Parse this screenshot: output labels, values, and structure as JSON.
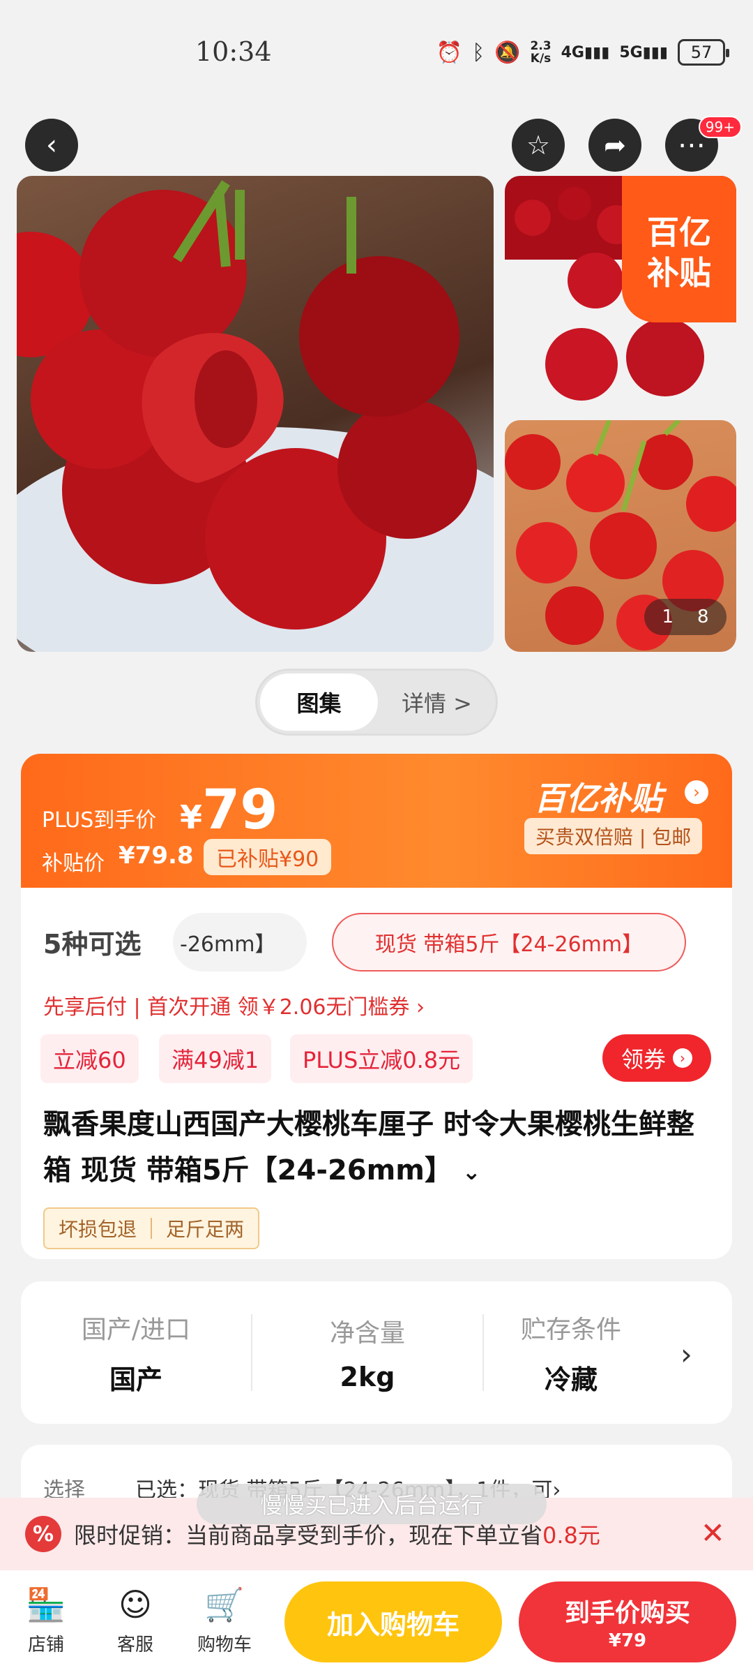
{
  "status": {
    "time": "10:34",
    "net_speed": "2.3\nK/s",
    "battery": "57",
    "icons": [
      "alarm-icon",
      "bluetooth-icon",
      "mute-icon",
      "signal-4g-icon",
      "signal-5g-icon"
    ]
  },
  "nav": {
    "badge": "99+"
  },
  "gallery": {
    "subsidy_corner": "百亿\n补贴",
    "counter_current": "1",
    "counter_total": "8"
  },
  "tabs": [
    {
      "label": "图集"
    },
    {
      "label": "详情 >"
    }
  ],
  "price": {
    "plus_label": "PLUS到手价",
    "currency": "¥",
    "plus_price": "79",
    "subsidy_label": "补贴价",
    "subsidy_price": "¥79.8",
    "subsidized_tag": "已补贴¥90",
    "brand": "百亿补贴",
    "guarantee": "买贵双倍赔 | 包邮"
  },
  "variants": {
    "count_label": "5种可选",
    "pill_text": "-26mm】",
    "selected": "现货 带箱5斤【24-26mm】"
  },
  "credit_line": "先享后付 | 首次开通 领￥2.06无门槛券 ›",
  "promos": [
    "立减60",
    "满49减1",
    "PLUS立减0.8元"
  ],
  "coupon_btn": "领券",
  "product_title": "飘香果度山西国产大樱桃车厘子 时令大果樱桃生鲜整箱 现货 带箱5斤【24-26mm】",
  "tags": [
    "坏损包退",
    "足斤足两"
  ],
  "specs": [
    {
      "key": "国产/进口",
      "value": "国产"
    },
    {
      "key": "净含量",
      "value": "2kg"
    },
    {
      "key": "贮存条件",
      "value": "冷藏"
    }
  ],
  "select": {
    "label": "选择",
    "value": "已选：现货 带箱5斤【24-26mm】，1件，可›"
  },
  "toast": "慢慢买已进入后台运行",
  "promo_banner": {
    "prefix": "限时促销：当前商品享受到手价，现在下单立省",
    "amount": "0.8元"
  },
  "bottom": {
    "store": "店铺",
    "service": "客服",
    "cart": "购物车",
    "add_cart": "加入购物车",
    "buy_label": "到手价购买",
    "buy_price": "¥79"
  },
  "colors": {
    "accent": "#ff6a1a",
    "red": "#f1333a",
    "yellow": "#ffc40d"
  }
}
